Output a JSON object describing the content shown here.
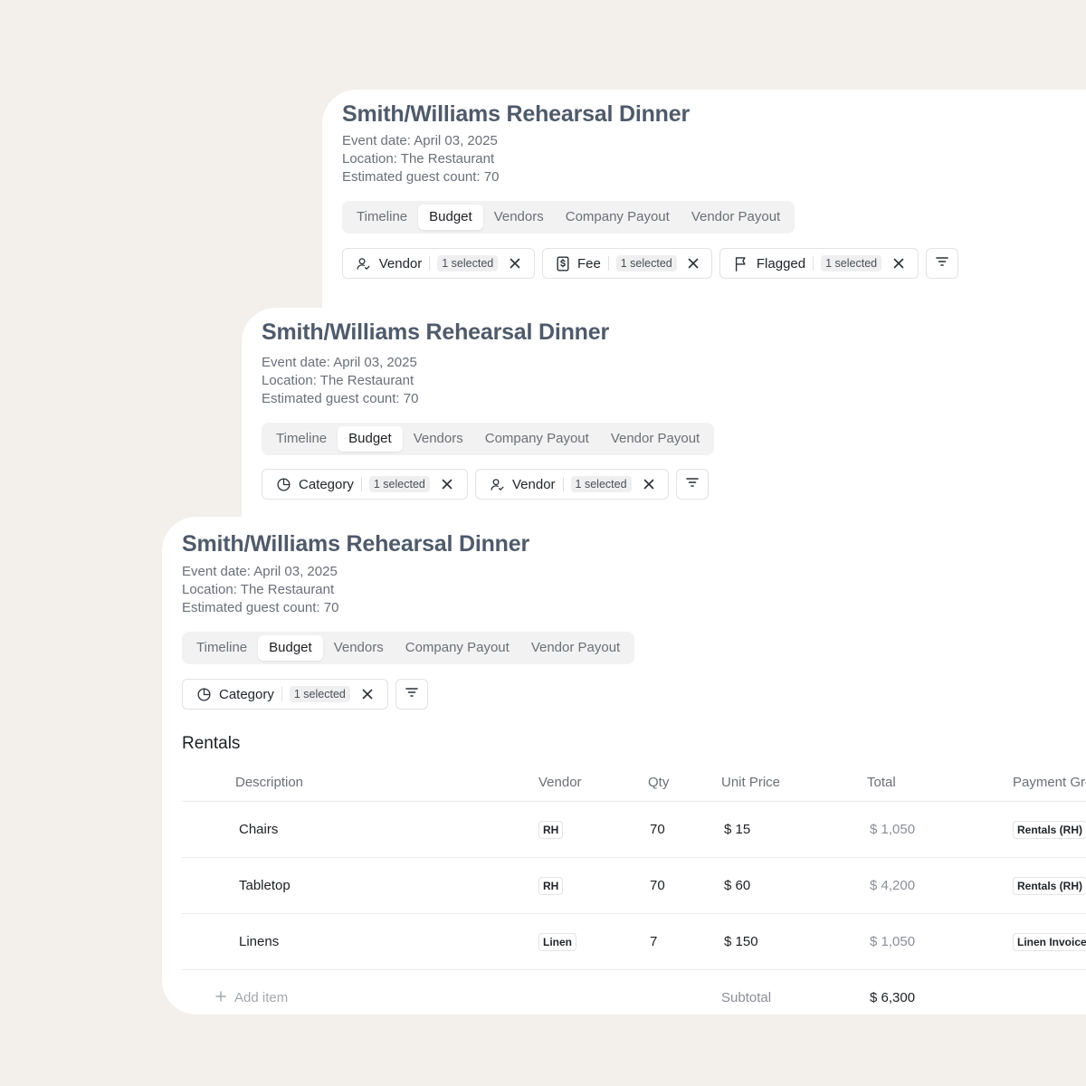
{
  "event": {
    "title": "Smith/Williams Rehearsal Dinner",
    "date": "Event date: April 03, 2025",
    "location": "Location: The Restaurant",
    "guests": "Estimated guest count: 70"
  },
  "tabs": [
    "Timeline",
    "Budget",
    "Vendors",
    "Company Payout",
    "Vendor Payout"
  ],
  "active_tab": "Budget",
  "card1_filters": [
    {
      "label": "Vendor",
      "badge": "1 selected",
      "icon": "user-check-icon"
    },
    {
      "label": "Fee",
      "badge": "1 selected",
      "icon": "dollar-doc-icon"
    },
    {
      "label": "Flagged",
      "badge": "1 selected",
      "icon": "flag-icon"
    }
  ],
  "card2_filters": [
    {
      "label": "Category",
      "badge": "1 selected",
      "icon": "pie-chart-icon"
    },
    {
      "label": "Vendor",
      "badge": "1 selected",
      "icon": "user-check-icon"
    }
  ],
  "card3_filters": [
    {
      "label": "Category",
      "badge": "1 selected",
      "icon": "pie-chart-icon"
    }
  ],
  "section": "Rentals",
  "columns": [
    "Description",
    "Vendor",
    "Qty",
    "Unit Price",
    "Total",
    "Payment Gro"
  ],
  "rows": [
    {
      "description": "Chairs",
      "vendor": "RH",
      "qty": "70",
      "unit_price": "$ 15",
      "total": "$ 1,050",
      "payment_group": "Rentals (RH)"
    },
    {
      "description": "Tabletop",
      "vendor": "RH",
      "qty": "70",
      "unit_price": "$ 60",
      "total": "$ 4,200",
      "payment_group": "Rentals (RH)"
    },
    {
      "description": "Linens",
      "vendor": "Linen",
      "qty": "7",
      "unit_price": "$ 150",
      "total": "$ 1,050",
      "payment_group": "Linen Invoice"
    }
  ],
  "footer": {
    "add_item": "Add item",
    "subtotal_label": "Subtotal",
    "subtotal_value": "$ 6,300"
  }
}
